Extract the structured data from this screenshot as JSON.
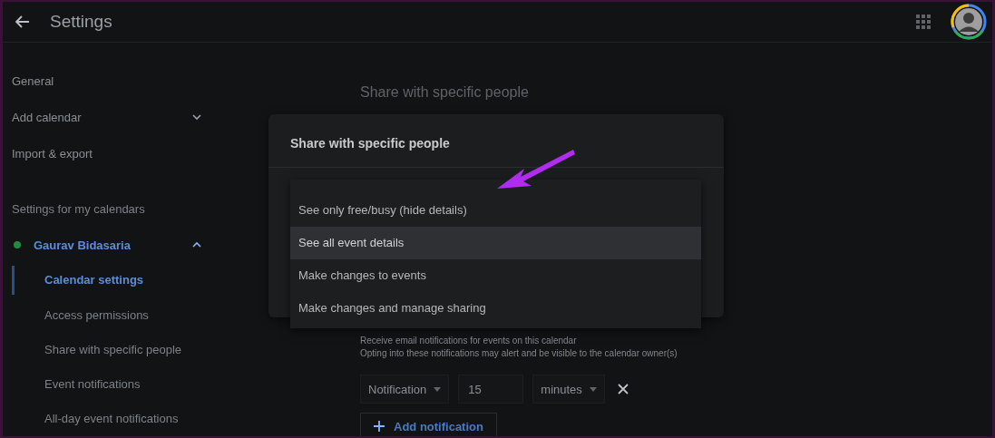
{
  "header": {
    "title": "Settings"
  },
  "sidebar": {
    "items": [
      {
        "label": "General",
        "kind": "link"
      },
      {
        "label": "Add calendar",
        "kind": "expander",
        "expanded": false
      },
      {
        "label": "Import & export",
        "kind": "link"
      }
    ],
    "section_title": "Settings for my calendars",
    "calendar": {
      "name": "Gaurav Bidasaria",
      "color": "#1e8e3e",
      "expanded": true,
      "children": [
        {
          "label": "Calendar settings",
          "selected": true
        },
        {
          "label": "Access permissions",
          "selected": false
        },
        {
          "label": "Share with specific people",
          "selected": false
        },
        {
          "label": "Event notifications",
          "selected": false
        },
        {
          "label": "All-day event notifications",
          "selected": false
        }
      ]
    }
  },
  "main": {
    "section_heading": "Share with specific people",
    "description": [
      "Receive email notifications for events on this calendar",
      "Opting into these notifications may alert and be visible to the calendar owner(s)"
    ],
    "notification": {
      "type": "Notification",
      "amount": "15",
      "unit": "minutes"
    },
    "add_button": "Add notification"
  },
  "dialog": {
    "title": "Share with specific people",
    "options": [
      {
        "label": "See only free/busy (hide details)",
        "selected": false
      },
      {
        "label": "See all event details",
        "selected": true
      },
      {
        "label": "Make changes to events",
        "selected": false
      },
      {
        "label": "Make changes and manage sharing",
        "selected": false
      }
    ]
  }
}
